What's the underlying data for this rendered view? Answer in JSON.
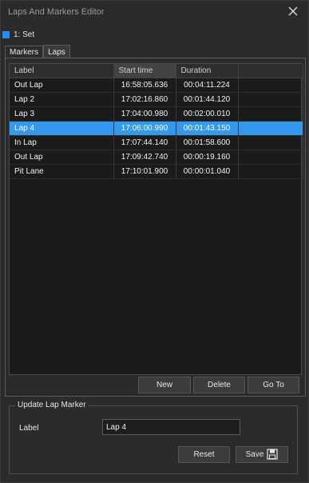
{
  "window": {
    "title": "Laps And Markers Editor"
  },
  "set": {
    "label": "1: Set",
    "color": "#1e90ff"
  },
  "tabs": [
    {
      "label": "Markers",
      "active": false
    },
    {
      "label": "Laps",
      "active": true
    }
  ],
  "table": {
    "columns": [
      "Label",
      "Start time",
      "Duration"
    ],
    "rows": [
      {
        "label": "Out Lap",
        "start": "16:58:05.636",
        "duration": "00:04:11.224"
      },
      {
        "label": "Lap 2",
        "start": "17:02:16.860",
        "duration": "00:01:44.120"
      },
      {
        "label": "Lap 3",
        "start": "17:04:00.980",
        "duration": "00:02:00.010"
      },
      {
        "label": "Lap 4",
        "start": "17:06:00.990",
        "duration": "00:01:43.150"
      },
      {
        "label": "In Lap",
        "start": "17:07:44.140",
        "duration": "00:01:58.600"
      },
      {
        "label": "Out Lap",
        "start": "17:09:42.740",
        "duration": "00:00:19.160"
      },
      {
        "label": "Pit Lane",
        "start": "17:10:01.900",
        "duration": "00:00:01.040"
      }
    ],
    "selected_index": 3
  },
  "actions": {
    "new": "New",
    "delete": "Delete",
    "goto": "Go To"
  },
  "update": {
    "title": "Update Lap Marker",
    "label_caption": "Label",
    "label_value": "Lap 4",
    "reset": "Reset",
    "save": "Save"
  },
  "colors": {
    "selection": "#3399ee",
    "background": "#2b2b2b",
    "accent": "#1e90ff"
  },
  "icons": {
    "close": "close-icon",
    "save": "floppy-disk-icon"
  }
}
